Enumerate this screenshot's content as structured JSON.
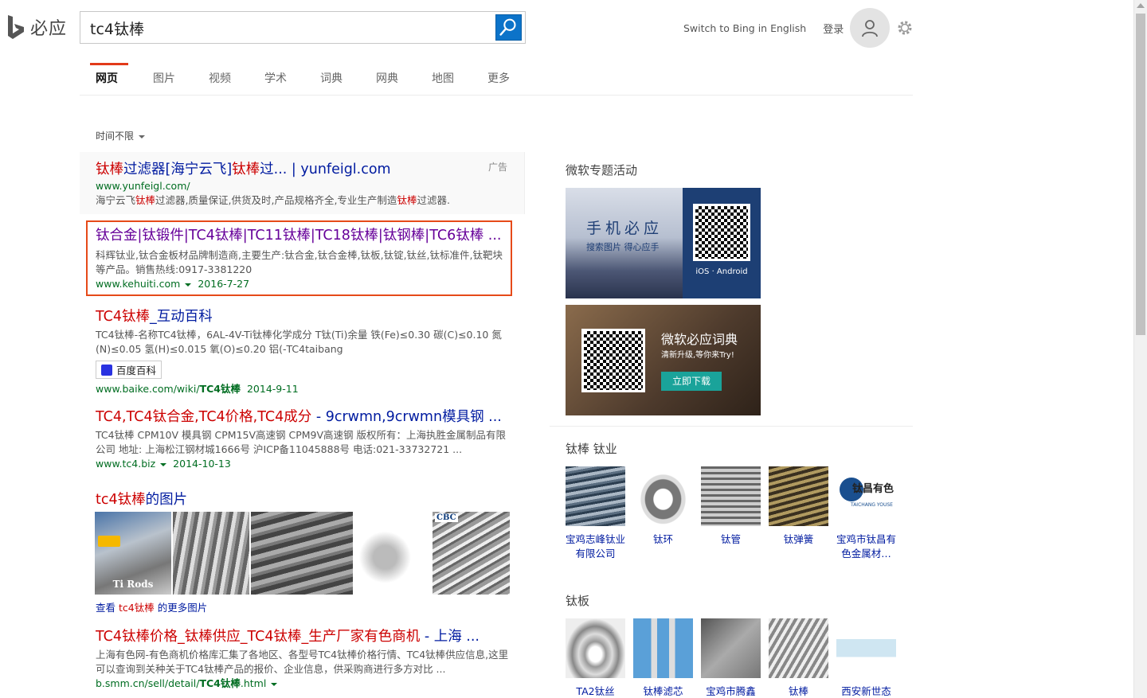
{
  "header": {
    "logo_text": "必应",
    "query": "tc4钛棒",
    "switch_lang": "Switch to Bing in English",
    "signin": "登录"
  },
  "tabs": [
    "网页",
    "图片",
    "视频",
    "学术",
    "词典",
    "网典",
    "地图",
    "更多"
  ],
  "filters": {
    "time": "时间不限"
  },
  "results": {
    "ad": {
      "title_em1": "钛棒",
      "title_mid": "过滤器[海宁云飞]",
      "title_em2": "钛棒",
      "title_tail": "过... | yunfeigl.com",
      "url": "www.yunfeigl.com/",
      "snippet_a": "海宁云飞",
      "snippet_em": "钛棒",
      "snippet_b": "过滤器,质量保证,供货及时,产品规格齐全,专业生产制造",
      "snippet_em2": "钛棒",
      "snippet_c": "过滤器.",
      "tag": "广告"
    },
    "r1": {
      "title": "钛合金|钛锻件|TC4钛棒|TC11钛棒|TC18钛棒|钛钢棒|TC6钛棒 ...",
      "snippet": "科辉钛业,钛合金板材品牌制造商,主要生产:钛合金,钛合金棒,钛板,钛锭,钛丝,钛标准件,钛靶块等产品。销售热线:0917-3381220",
      "url": "www.kehuiti.com",
      "date": "2016-7-27"
    },
    "r2": {
      "title_a": "TC4钛棒",
      "title_b": "_互动百科",
      "snippet_line1": "TC4钛棒-名称TC4钛棒，6AL-4V-Ti钛棒化学成分 T钛(Ti)余量 铁(Fe)≤0.30 碳(C)≤0.10 氮",
      "snippet_line2": "(N)≤0.05 氢(H)≤0.015 氧(O)≤0.20 铝(-TC4taibang",
      "badge": "百度百科",
      "url": "www.baike.com/wiki/",
      "url_bold": "TC4钛棒",
      "date": "2014-9-11"
    },
    "r3": {
      "title_a": "TC4,TC4钛合金,TC4价格,TC4成分",
      "title_b": " - 9crwmn,9crwmn模具钢 ...",
      "snippet": "TC4钛棒 CPM10V 模具钢 CPM15V高速钢 CPM9V高速钢 版权所有：上海执胜金属制品有限公司 地址: 上海松江钢材城1666号 沪ICP备11045888号 电话:021-33732721 ...",
      "url": "www.tc4.biz",
      "date": "2014-10-13"
    },
    "images": {
      "title_a": "tc4钛棒",
      "title_b": "的图片",
      "more_a": "查看 ",
      "more_em": "tc4钛棒",
      "more_b": " 的更多图片",
      "thumb1_caption": "Ti Rods",
      "thumb5_caption": "CBC"
    },
    "r4": {
      "title_a": "TC4钛棒价格_钛棒供应_TC4钛棒_生产厂家有色商机",
      "title_b": " - 上海 ...",
      "snippet": "上海有色网-有色商机价格库汇集了各地区、各型号TC4钛棒价格行情、TC4钛棒供应信息,这里可以查询到关种关于TC4钛棒产品的报价、企业信息，供采购商进行多方对比 ...",
      "url": "b.smm.cn/sell/detail/",
      "url_bold": "TC4钛棒",
      "url_tail": ".html"
    }
  },
  "rail": {
    "promo_heading": "微软专题活动",
    "promo1": {
      "title": "手机必应",
      "subtitle": "搜索图片 得心应手",
      "platforms": "iOS · Android"
    },
    "promo2": {
      "title": "微软必应词典",
      "subtitle": "清新升级,等你来Try!",
      "button": "立即下载"
    },
    "section1": {
      "heading": "钛棒 钛业",
      "items": [
        "宝鸡志峰钛业有限公司",
        "钛环",
        "钛管",
        "钛弹簧",
        "宝鸡市钛昌有色金属材…"
      ]
    },
    "section2": {
      "heading": "钛板",
      "items": [
        "TA2钛丝",
        "钛棒滤芯",
        "宝鸡市腾鑫",
        "钛棒",
        "西安新世态"
      ]
    },
    "logo_text": "钛昌有色",
    "logo_sub": "TAICHANG YOUSE"
  }
}
